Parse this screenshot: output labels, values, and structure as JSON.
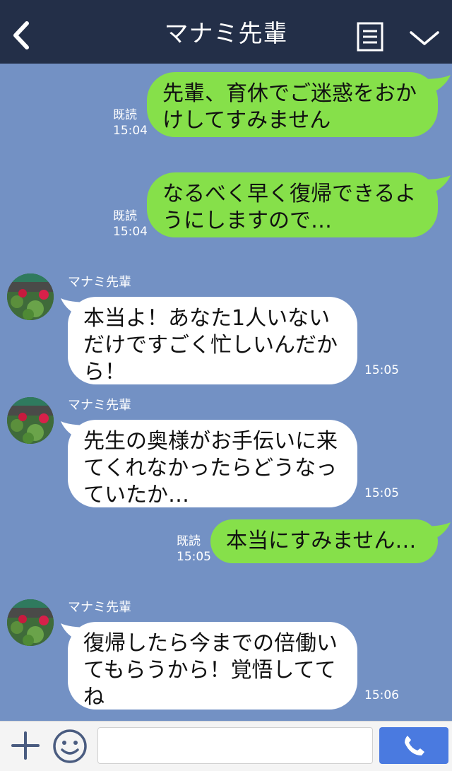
{
  "header": {
    "title": "マナミ先輩",
    "back_icon": "chevron-left-icon",
    "menu_icon": "note-icon",
    "collapse_icon": "chevron-down-icon",
    "background": "#232f48"
  },
  "chat": {
    "background": "#7391c4",
    "outgoing_color": "#86e04a",
    "incoming_color": "#ffffff",
    "messages": [
      {
        "direction": "out",
        "text": "先輩、育休でご迷惑をおか\nけしてすみません",
        "read": "既読",
        "time": "15:04"
      },
      {
        "direction": "out",
        "text": "なるべく早く復帰できるよ\nうにしますので…",
        "read": "既読",
        "time": "15:04"
      },
      {
        "direction": "in",
        "sender": "マナミ先輩",
        "text": "本当よ！あなた1人いない\nだけですごく忙しいんだか\nら！",
        "time": "15:05"
      },
      {
        "direction": "in",
        "sender": "マナミ先輩",
        "text": "先生の奥様がお手伝いに来\nてくれなかったらどうなっ\nていたか…",
        "time": "15:05"
      },
      {
        "direction": "out",
        "text": "本当にすみません…",
        "read": "既読",
        "time": "15:05"
      },
      {
        "direction": "in",
        "sender": "マナミ先輩",
        "text": "復帰したら今までの倍働い\nてもらうから！覚悟してて\nね",
        "time": "15:06"
      }
    ]
  },
  "input_bar": {
    "plus_icon": "plus-icon",
    "emoji_icon": "smiley-icon",
    "message_value": "",
    "call_icon": "phone-icon",
    "call_button_color": "#4a7ae0"
  }
}
